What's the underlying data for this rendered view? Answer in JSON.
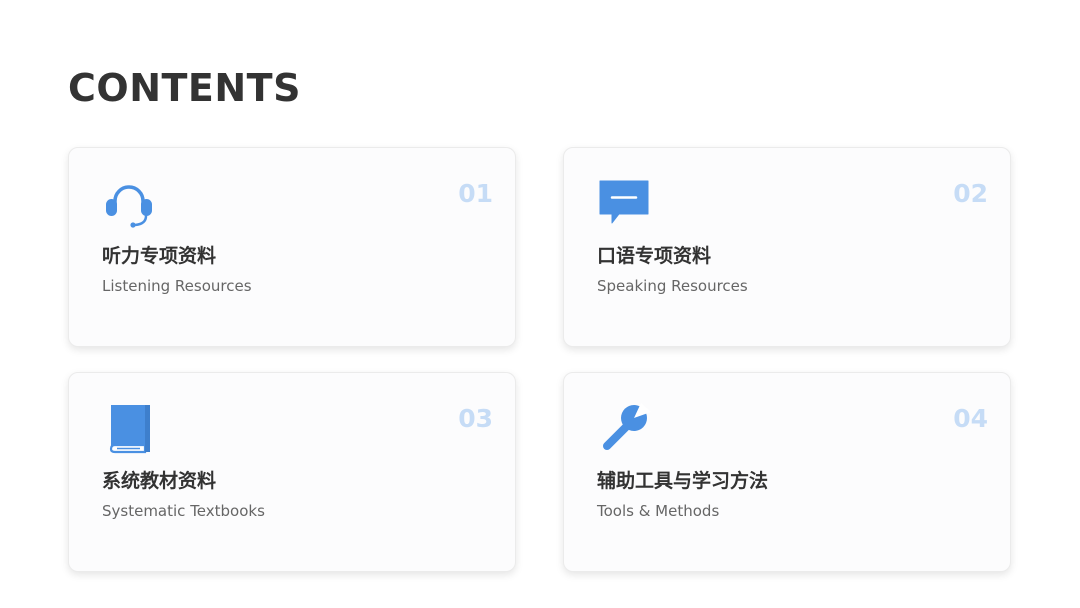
{
  "page": {
    "title": "CONTENTS",
    "accent_color": "#4a90e2",
    "number_color": "#c6dcf6"
  },
  "cards": [
    {
      "number": "01",
      "icon": "headset-icon",
      "title": "听力专项资料",
      "subtitle": "Listening Resources"
    },
    {
      "number": "02",
      "icon": "chat-bubble-icon",
      "title": "口语专项资料",
      "subtitle": "Speaking Resources"
    },
    {
      "number": "03",
      "icon": "book-icon",
      "title": "系统教材资料",
      "subtitle": "Systematic Textbooks"
    },
    {
      "number": "04",
      "icon": "wrench-icon",
      "title": "辅助工具与学习方法",
      "subtitle": "Tools & Methods"
    }
  ]
}
